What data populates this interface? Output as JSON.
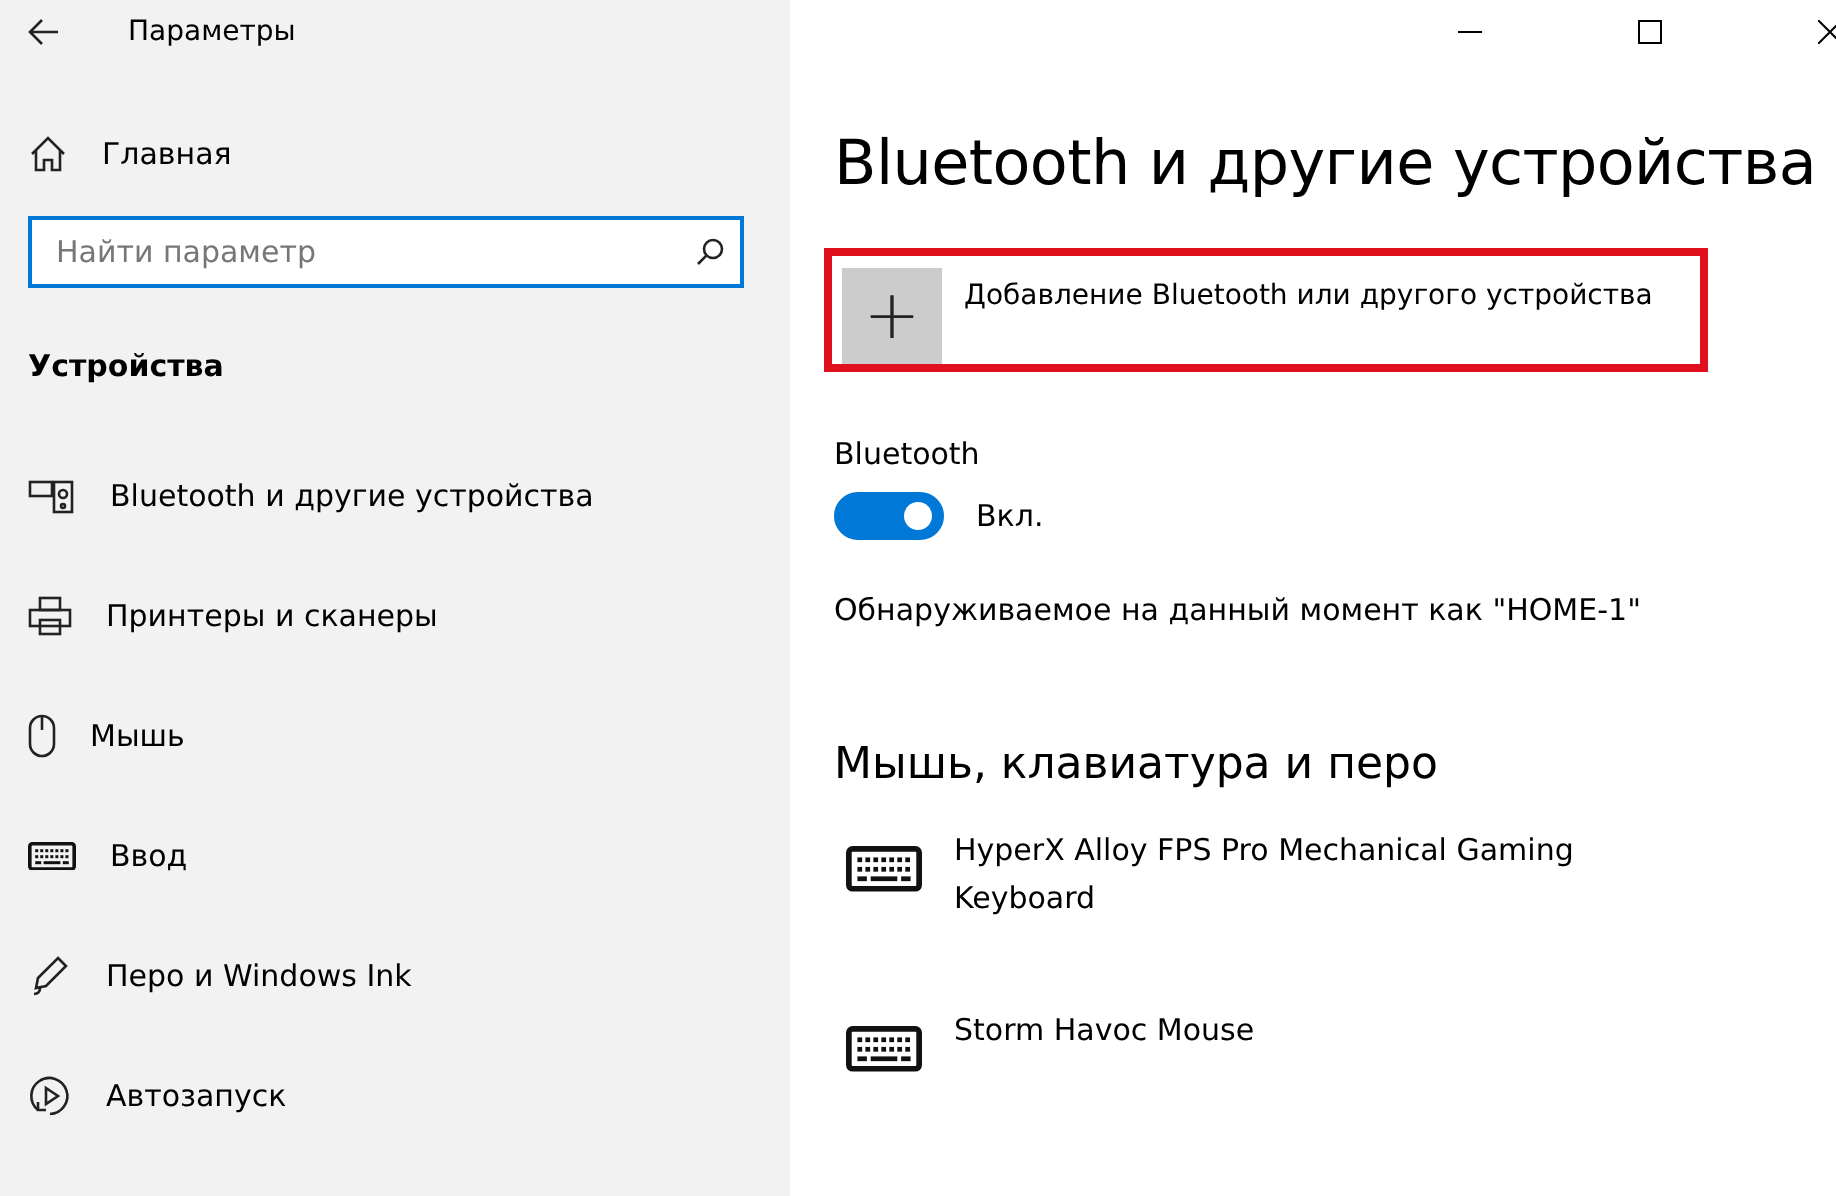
{
  "window": {
    "title": "Параметры"
  },
  "sidebar": {
    "home": "Главная",
    "search": {
      "placeholder": "Найти параметр"
    },
    "section": "Устройства",
    "items": [
      {
        "label": "Bluetooth и другие устройства"
      },
      {
        "label": "Принтеры и сканеры"
      },
      {
        "label": "Мышь"
      },
      {
        "label": "Ввод"
      },
      {
        "label": "Перо и Windows Ink"
      },
      {
        "label": "Автозапуск"
      }
    ]
  },
  "page": {
    "title": "Bluetooth и другие устройства",
    "add_device": {
      "label": "Добавление Bluetooth или другого устройства",
      "icon": "+"
    },
    "bluetooth": {
      "label": "Bluetooth",
      "on": true,
      "state_text": "Вкл."
    },
    "discoverable": "Обнаруживаемое на данный момент как \"HOME-1\"",
    "section": "Мышь, клавиатура и перо",
    "devices": [
      {
        "name": "HyperX Alloy FPS Pro Mechanical Gaming Keyboard"
      },
      {
        "name": "Storm Havoc Mouse"
      }
    ]
  }
}
